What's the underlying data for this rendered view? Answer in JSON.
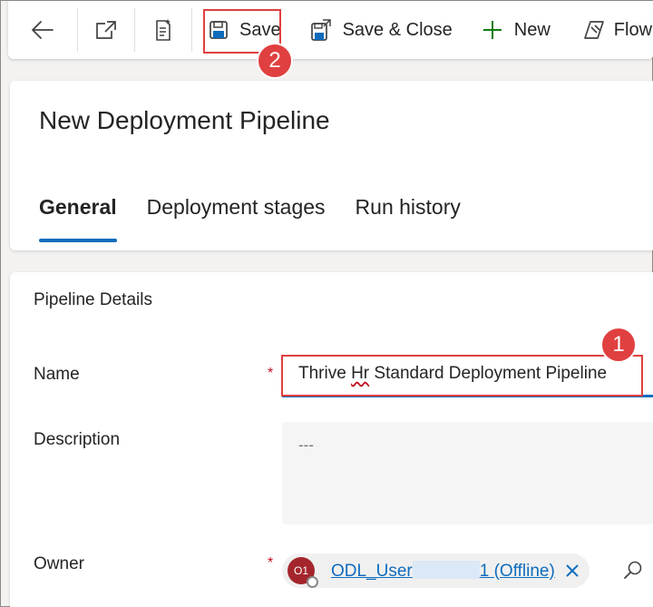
{
  "toolbar": {
    "save_label": "Save",
    "save_close_label": "Save & Close",
    "new_label": "New",
    "flow_label": "Flow"
  },
  "header": {
    "title": "New Deployment Pipeline",
    "tabs": [
      {
        "label": "General",
        "active": true
      },
      {
        "label": "Deployment stages",
        "active": false
      },
      {
        "label": "Run history",
        "active": false
      }
    ]
  },
  "details": {
    "section_title": "Pipeline Details",
    "name_label": "Name",
    "name_value_part1": "Thrive ",
    "name_value_misspelled": "Hr",
    "name_value_part2": " Standard Deployment Pipeline",
    "description_label": "Description",
    "description_placeholder": "---",
    "owner_label": "Owner",
    "owner_initials": "O1",
    "owner_name_prefix": "ODL_User",
    "owner_name_suffix": "1 (Offline)",
    "required_mark": "*"
  },
  "annotations": {
    "badge1": "1",
    "badge2": "2",
    "color": "#e0403f"
  },
  "colors": {
    "accent": "#0f6cbd",
    "required": "#c50f1f",
    "avatar": "#a4262c"
  },
  "icons": [
    "back-arrow-icon",
    "popout-icon",
    "checker-icon",
    "save-icon",
    "save-close-icon",
    "add-icon",
    "flow-icon",
    "close-icon",
    "search-icon"
  ]
}
